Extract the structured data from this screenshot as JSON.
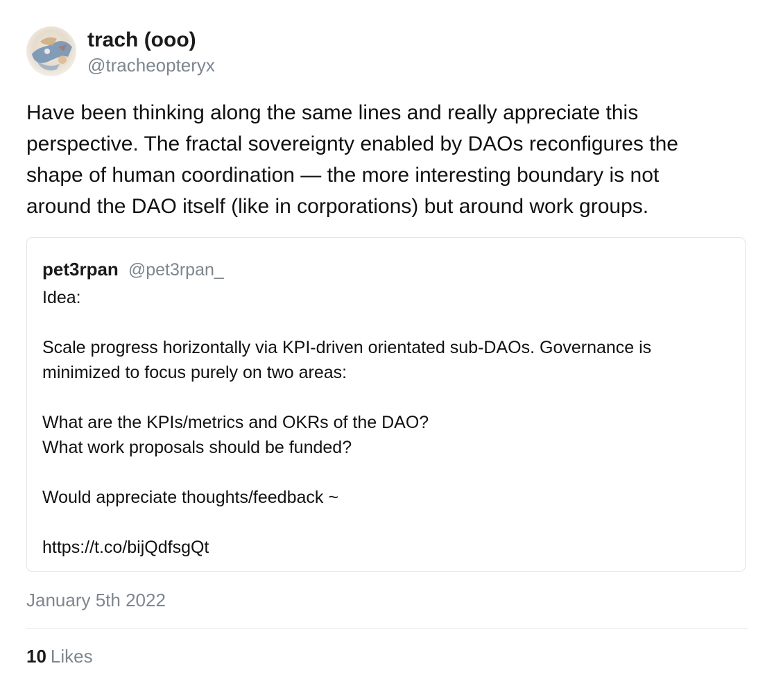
{
  "author": {
    "name": "trach (ooo)",
    "handle": "@tracheopteryx"
  },
  "tweet": {
    "lines": [
      "Have been thinking along the same lines and really appreciate this",
      "perspective.  The fractal sovereignty enabled by DAOs reconfigures the",
      "shape of human coordination — the more interesting boundary is not",
      "around the DAO itself (like in corporations) but around work groups."
    ]
  },
  "quoted_tweet": {
    "name": "pet3rpan",
    "handle": "@pet3rpan_",
    "lines": [
      "Idea:",
      "",
      "Scale progress horizontally via KPI-driven orientated sub-DAOs. Governance is",
      "minimized to focus purely on two areas:",
      "",
      "What are the KPIs/metrics and OKRs of the DAO?",
      "What work proposals should be funded?",
      "",
      "Would appreciate thoughts/feedback ~",
      "",
      "https://t.co/bijQdfsgQt"
    ]
  },
  "date": "January 5th 2022",
  "likes": {
    "count": "10",
    "label": "Likes"
  }
}
